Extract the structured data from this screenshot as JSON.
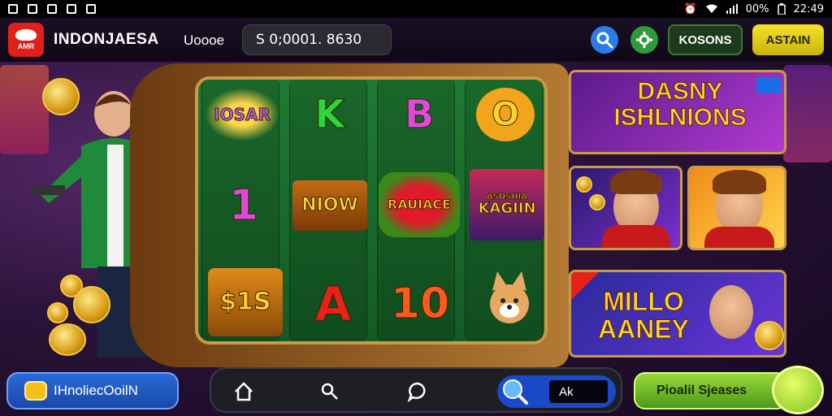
{
  "status_bar": {
    "battery": "00%",
    "time": "22:49"
  },
  "header": {
    "logo_text": "AMR",
    "brand": "INDONJAESA",
    "user_label": "Uoooe",
    "balance": "S 0;0001. 8630",
    "bonus_button": "KOSONS",
    "login_button": "ASTAIN"
  },
  "reels": {
    "symbols": [
      "IOSAR",
      "K",
      "B",
      "O",
      "1",
      "NIOW",
      "RAUIACE",
      "KAGIIN",
      "$1S",
      "A",
      "10",
      "",
      "KAGIIN_SUB"
    ],
    "sub_label": "ASDSHIA"
  },
  "promos": {
    "card1_title": "DASNY ISHLNIONS",
    "card4_title": "MILLO AANEY"
  },
  "bottom_bar": {
    "promo_left": "IHnoliecOoilN",
    "nav_search_value": "Ak",
    "play_button": "Pioalil Sjeases"
  },
  "colors": {
    "accent_yellow": "#f6e02a",
    "felt_green": "#1f7a32",
    "gold_trim": "#c89a4a",
    "nav_blue": "#1a4ac8"
  }
}
